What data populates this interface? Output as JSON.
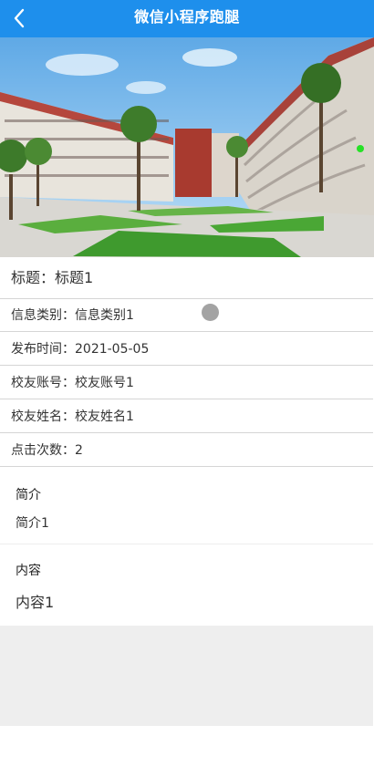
{
  "nav": {
    "title": "微信小程序跑腿",
    "back_icon": "chevron-left-icon"
  },
  "details": [
    {
      "label": "标题：",
      "value": "标题1"
    },
    {
      "label": "信息类别：",
      "value": "信息类别1"
    },
    {
      "label": "发布时间：",
      "value": "2021-05-05"
    },
    {
      "label": "校友账号：",
      "value": "校友账号1"
    },
    {
      "label": "校友姓名：",
      "value": "校友姓名1"
    },
    {
      "label": "点击次数：",
      "value": "2"
    }
  ],
  "intro": {
    "heading": "简介",
    "text": "简介1"
  },
  "content": {
    "heading": "内容",
    "text": "内容1"
  },
  "colors": {
    "accent": "#1e8fec"
  }
}
